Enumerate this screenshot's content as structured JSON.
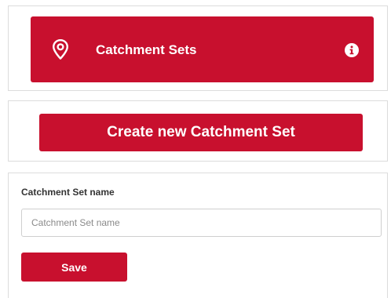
{
  "header": {
    "title": "Catchment Sets",
    "pin_icon": "map-pin-icon",
    "info_icon": "info-icon"
  },
  "create": {
    "button_label": "Create new Catchment Set"
  },
  "form": {
    "name_label": "Catchment Set name",
    "name_placeholder": "Catchment Set name",
    "name_value": "",
    "save_label": "Save"
  },
  "colors": {
    "brand_red": "#c8102e",
    "panel_border": "#dcdcdc",
    "text_dark": "#333333",
    "placeholder": "#8a8a8a"
  }
}
